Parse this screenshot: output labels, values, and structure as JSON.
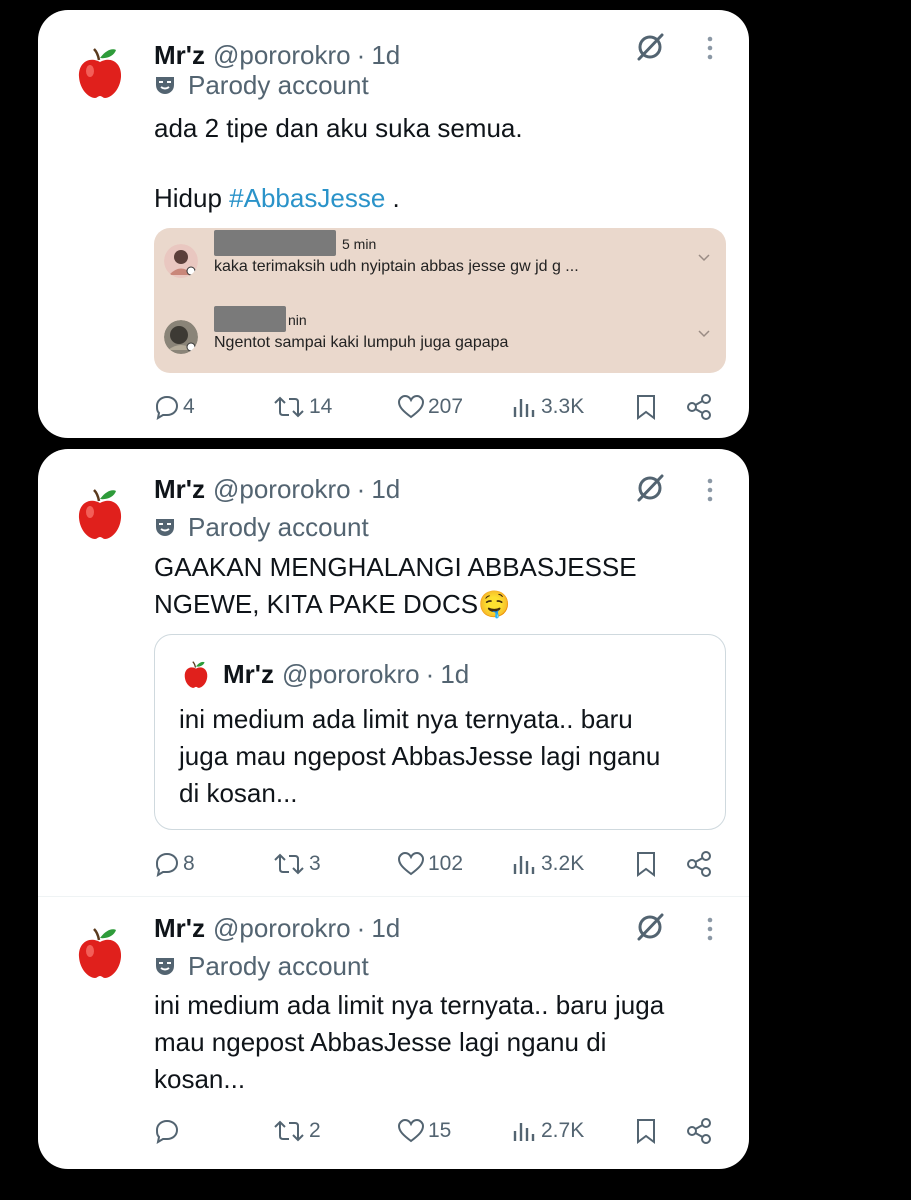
{
  "colors": {
    "background": "#000000",
    "card": "#ffffff",
    "text": "#0f1419",
    "muted": "#536471",
    "hashtag": "#2a93c9",
    "embed_bg": "#ead8cc"
  },
  "tweets": [
    {
      "name": "Mr'z",
      "handle": "@pororokro",
      "dot": "·",
      "time": "1d",
      "badge": "Parody account",
      "text_line1": "ada 2 tipe dan aku suka semua.",
      "text_prefix": "Hidup",
      "hashtag": "#AbbasJesse",
      "text_suffix": ".",
      "embed": {
        "comments": [
          {
            "meta": "5 min",
            "body": "kaka terimaksih udh nyiptain abbas jesse gw jd g ..."
          },
          {
            "meta": "nin",
            "body": "Ngentot sampai kaki lumpuh juga gapapa"
          }
        ]
      },
      "actions": {
        "replies": "4",
        "reposts": "14",
        "likes": "207",
        "views": "3.3K"
      }
    },
    {
      "name": "Mr'z",
      "handle": "@pororokro",
      "dot": "·",
      "time": "1d",
      "badge": "Parody account",
      "text_line1": "GAAKAN MENGHALANGI ABBASJESSE",
      "text_line2": "NGEWE, KITA PAKE DOCS🤤",
      "quote": {
        "name": "Mr'z",
        "handle": "@pororokro",
        "dot": "·",
        "time": "1d",
        "line1": "ini medium ada limit nya ternyata.. baru",
        "line2": "juga mau ngepost AbbasJesse lagi nganu",
        "line3": "di kosan..."
      },
      "actions": {
        "replies": "8",
        "reposts": "3",
        "likes": "102",
        "views": "3.2K"
      }
    },
    {
      "name": "Mr'z",
      "handle": "@pororokro",
      "dot": "·",
      "time": "1d",
      "badge": "Parody account",
      "text_line1": "ini medium ada limit nya ternyata.. baru juga",
      "text_line2": "mau ngepost AbbasJesse lagi nganu di",
      "text_line3": "kosan...",
      "actions": {
        "replies": "",
        "reposts": "2",
        "likes": "15",
        "views": "2.7K"
      }
    }
  ],
  "icons": {
    "avatar": "red-apple-icon",
    "badge": "parody-mask-icon",
    "grok": "grok-slash-icon",
    "more": "more-vertical-icon",
    "reply": "reply-icon",
    "repost": "repost-icon",
    "like": "heart-icon",
    "views": "views-icon",
    "bookmark": "bookmark-icon",
    "share": "share-icon"
  }
}
